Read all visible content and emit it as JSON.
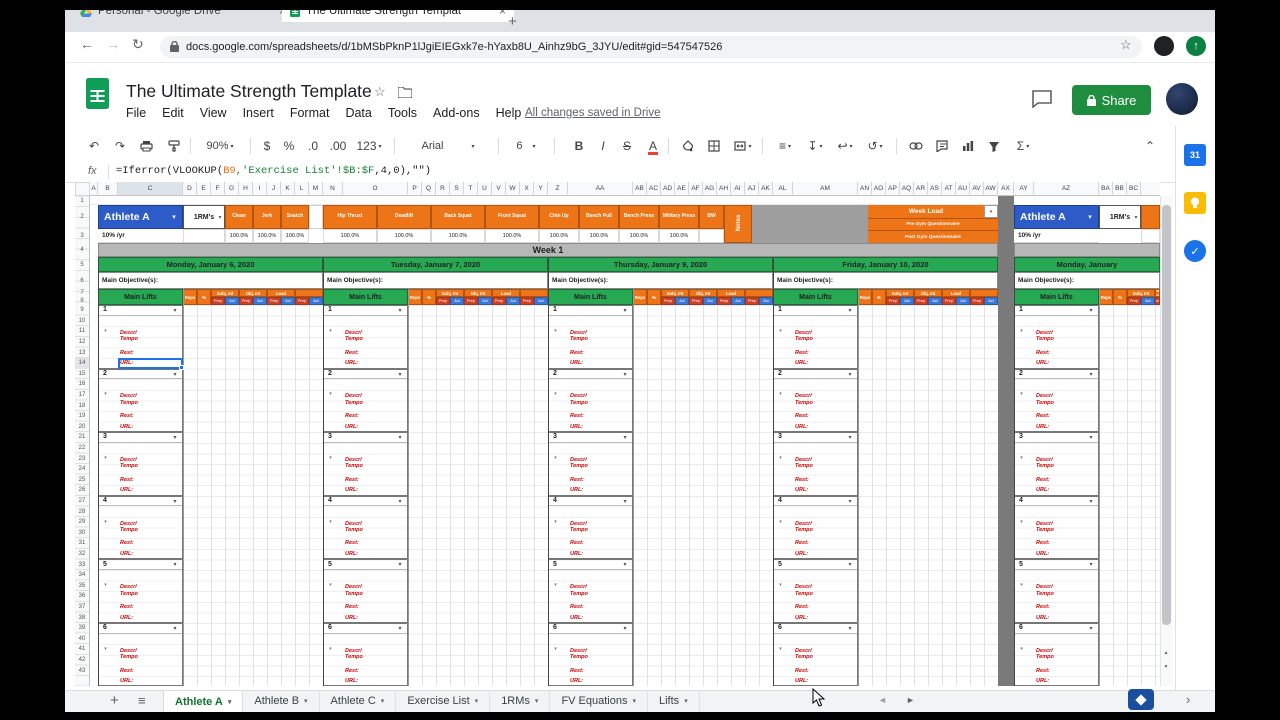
{
  "chrome": {
    "tabs": [
      {
        "title": "Personal - Google Drive"
      },
      {
        "title": "The Ultimate Strength Templat"
      }
    ],
    "new_tab": "+",
    "url": "docs.google.com/spreadsheets/d/1bMSbPknP1lJgiEIEGxk7e-hYaxb8U_Ainhz9bG_3JYU/edit#gid=547547526"
  },
  "header": {
    "title": "The Ultimate Strength Template",
    "menus": [
      "File",
      "Edit",
      "View",
      "Insert",
      "Format",
      "Data",
      "Tools",
      "Add-ons",
      "Help"
    ],
    "saved": "All changes saved in Drive",
    "share": "Share"
  },
  "toolbar": {
    "zoom": "90%",
    "font": "Arial",
    "size": "6"
  },
  "formula_bar": {
    "fx": "fx",
    "parts": [
      {
        "text": "=Iferror(VLOOKUP(",
        "color": "#202124"
      },
      {
        "text": "B9",
        "color": "#e8710a"
      },
      {
        "text": ",'Exercise List'!$B:$F",
        "color": "#188038"
      },
      {
        "text": ",4,0),\"\")",
        "color": "#202124"
      }
    ]
  },
  "grid": {
    "columns": [
      "A",
      "B",
      "C",
      "D",
      "E",
      "F",
      "G",
      "H",
      "I",
      "J",
      "K",
      "L",
      "M",
      "N",
      "O",
      "P",
      "Q",
      "R",
      "S",
      "T",
      "U",
      "V",
      "W",
      "X",
      "Y",
      "Z",
      "AA",
      "AB",
      "AC",
      "AD",
      "AE",
      "AF",
      "AG",
      "AH",
      "AI",
      "AJ",
      "AK",
      "AL",
      "AM",
      "AN",
      "AO",
      "AP",
      "AQ",
      "AR",
      "AS",
      "AT",
      "AU",
      "AV",
      "AW",
      "AX",
      "AY",
      "AZ",
      "BA",
      "BB",
      "BC"
    ],
    "row_count": 43,
    "athlete": "Athlete A",
    "rm": "1RM's",
    "rm_note": "10% /yr",
    "lifts": [
      "Clean",
      "Jerk",
      "Snatch",
      "Hip Thrust",
      "Deadlift",
      "Back Squat",
      "Front Squat",
      "Chin Up",
      "Bench Pull",
      "Bench Press",
      "Military Press",
      "BW"
    ],
    "pct": "100.0%",
    "notes": "Notes",
    "week_load": "Week Load",
    "pre_gym": "Pre Gym Questionnaire",
    "post_gym": "Post Gym Questionnaire",
    "week": "Week 1",
    "days": [
      "Monday, January 6, 2020",
      "Tuesday, January 7, 2020",
      "Thursday, January 9, 2020",
      "Friday, January 10, 2020"
    ],
    "right_day": "Monday, January",
    "objective": "Main Objective(s):",
    "main_lifts": "Main Lifts",
    "mini": {
      "reps": "Reps",
      "pct": "%",
      "subj": "Subj. Int",
      "obj": "Obj. Int",
      "load": "Load",
      "prep": "Prep",
      "act": "Act"
    },
    "group_numbers": [
      "1",
      "2",
      "3",
      "4",
      "5",
      "6"
    ],
    "descr1": "Descr/",
    "descr2": "Tempo",
    "rest": "Rest:",
    "url": "URL:"
  },
  "sheetbar": {
    "tabs": [
      {
        "label": "Athlete A",
        "active": true
      },
      {
        "label": "Athlete B"
      },
      {
        "label": "Athlete C"
      },
      {
        "label": "Exercise List"
      },
      {
        "label": "1RMs"
      },
      {
        "label": "FV Equations"
      },
      {
        "label": "Lifts"
      }
    ]
  },
  "icons": {
    "glyphs": {
      "dropdown": "▾",
      "back": "←",
      "forward": "→",
      "reload": "↻",
      "undo": "↶",
      "redo": "↷",
      "currency": "$",
      "percent": "%",
      "dec_dec": ".0",
      "inc_dec": ".00",
      "num_fmt": "123",
      "bold": "B",
      "italic": "I",
      "strike": "S",
      "text_color": "A",
      "align": "≡",
      "valign": "↧",
      "wrap": "↩",
      "rotate": "↺",
      "sigma": "Σ",
      "collapse": "⌃",
      "star": "☆",
      "plus": "+",
      "menu": "≡",
      "tab_left": "◄",
      "tab_right": "►",
      "panel_collapse": "›",
      "scroll_down": "▼",
      "scroll_up": "▲",
      "close": "×",
      "check": "✓",
      "calendar_day": "31",
      "up": "↑"
    }
  },
  "colors": {
    "orange": "#ed7417",
    "blue": "#2d5bc7",
    "green": "#27a853",
    "week_gray": "#b7b7b7",
    "divider_gray": "#7a7a7a",
    "label_red": "#cc0000",
    "selection_blue": "#1a73e8"
  }
}
